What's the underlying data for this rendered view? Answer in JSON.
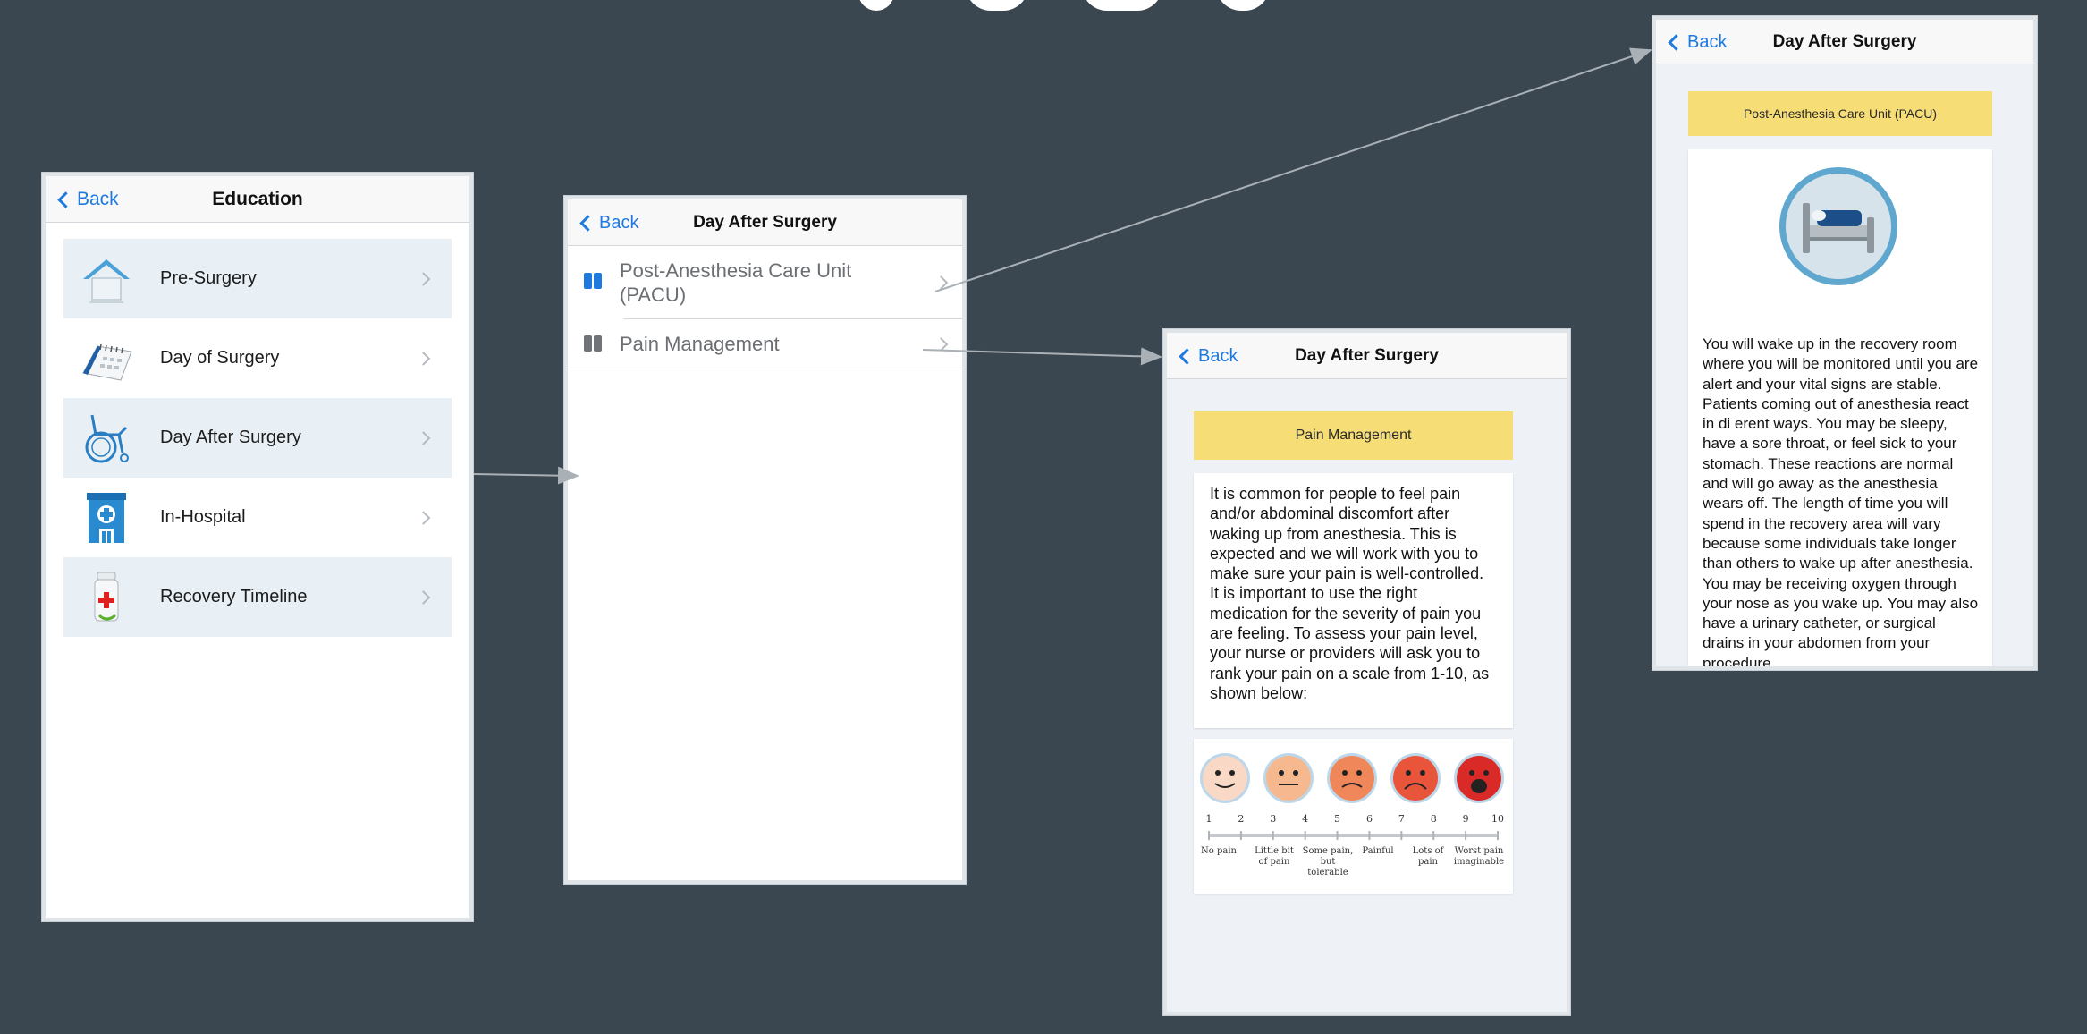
{
  "screen1": {
    "back_label": "Back",
    "title": "Education",
    "items": [
      {
        "label": "Pre-Surgery"
      },
      {
        "label": "Day of Surgery"
      },
      {
        "label": "Day After Surgery"
      },
      {
        "label": "In-Hospital"
      },
      {
        "label": "Recovery Timeline"
      }
    ]
  },
  "screen2": {
    "back_label": "Back",
    "title": "Day After Surgery",
    "items": [
      {
        "label": "Post-Anesthesia Care Unit (PACU)"
      },
      {
        "label": "Pain Management"
      }
    ]
  },
  "screen3": {
    "back_label": "Back",
    "title": "Day After Surgery",
    "banner": "Pain Management",
    "body": "It is common for people to feel pain and/or abdominal discomfort after waking up from anesthesia. This is expected and we will work with you to make sure your pain is well-controlled. It is important to use the right medication for the severity of pain you are feeling. To assess your pain level, your nurse or providers will ask you to rank your pain on a scale from 1-10, as shown below:",
    "scale": {
      "numbers": [
        "1",
        "2",
        "3",
        "4",
        "5",
        "6",
        "7",
        "8",
        "9",
        "10"
      ],
      "labels": [
        "No pain",
        "Little bit of pain",
        "Some pain, but tolerable",
        "Painful",
        "Lots of pain",
        "Worst pain imaginable"
      ],
      "face_colors": [
        "#f9d9c6",
        "#f6b98f",
        "#f0875a",
        "#e8553a",
        "#d92a27"
      ]
    }
  },
  "screen4": {
    "back_label": "Back",
    "title": "Day After Surgery",
    "banner": "Post-Anesthesia Care Unit (PACU)",
    "body": "You will wake up in the recovery room where you will be monitored until you are alert and your vital signs are stable. Patients coming out of anesthesia react in di erent ways. You may be sleepy, have a sore throat, or feel sick to your stomach. These reactions are normal and will go away as the anesthesia wears off. The length of time you will spend in the recovery area will vary because some individuals take longer than others to wake up after anesthesia. You may be receiving oxygen through your nose as you wake up. You may also have a urinary catheter, or surgical drains in your abdomen from your procedure."
  },
  "colors": {
    "background": "#3a4650",
    "accent": "#1f7ae0",
    "banner": "#f7dd76",
    "arrow": "#a9b0b6"
  }
}
